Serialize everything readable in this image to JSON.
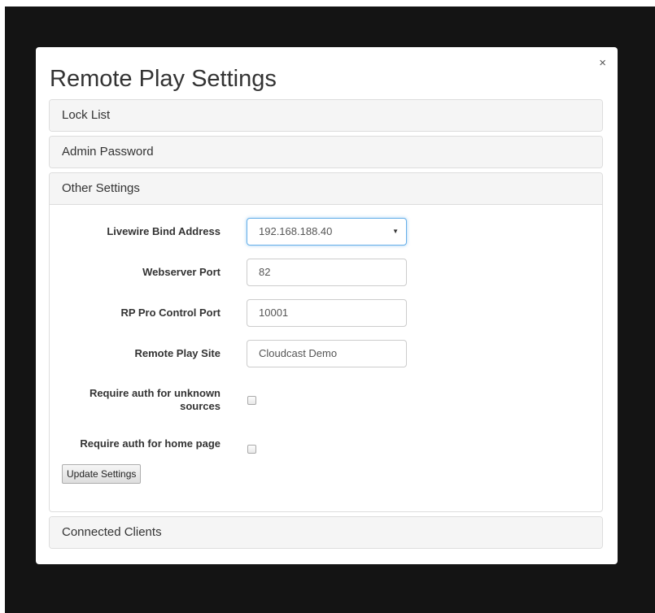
{
  "modal": {
    "title": "Remote Play Settings",
    "close_label": "×"
  },
  "panels": {
    "lock_list": {
      "label": "Lock List"
    },
    "admin_password": {
      "label": "Admin Password"
    },
    "other_settings": {
      "label": "Other Settings"
    },
    "connected_clients": {
      "label": "Connected Clients"
    }
  },
  "settings": {
    "livewire_bind_address": {
      "label": "Livewire Bind Address",
      "value": "192.168.188.40"
    },
    "webserver_port": {
      "label": "Webserver Port",
      "value": "82"
    },
    "rp_pro_control_port": {
      "label": "RP Pro Control Port",
      "value": "10001"
    },
    "remote_play_site": {
      "label": "Remote Play Site",
      "value": "Cloudcast Demo"
    },
    "require_auth_unknown": {
      "label_line1": "Require auth for unknown",
      "label_line2": "sources",
      "checked": false
    },
    "require_auth_home": {
      "label": "Require auth for home page",
      "checked": false
    },
    "update_button": "Update Settings"
  },
  "icons": {
    "close": "close-icon",
    "dropdown": "chevron-down-icon"
  }
}
